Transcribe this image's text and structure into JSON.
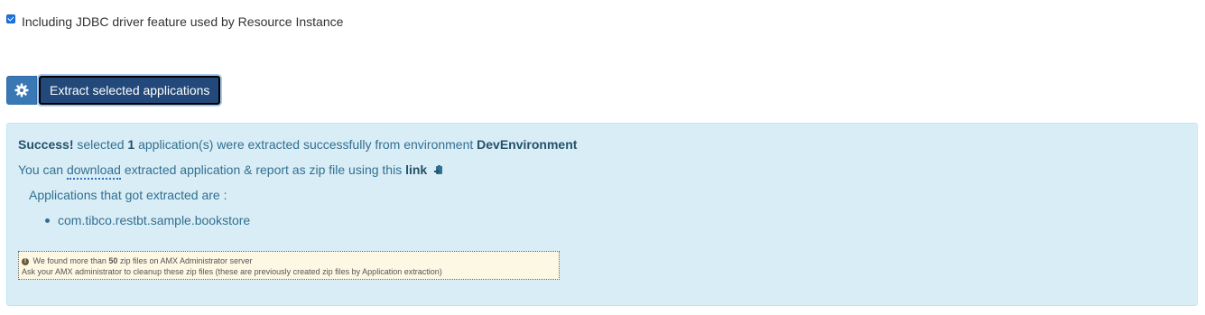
{
  "checkbox": {
    "label": "Including JDBC driver feature used by Resource Instance",
    "checked": true
  },
  "actions": {
    "gear_icon": "gear-icon",
    "extract_label": "Extract selected applications"
  },
  "alert": {
    "success_word": "Success!",
    "text_selected": "selected",
    "count": "1",
    "text_extracted": "application(s) were extracted successfully from environment",
    "environment": "DevEnvironment",
    "you_can": "You can",
    "download": "download",
    "text_report": "extracted application & report as zip file using this",
    "link": "link",
    "link_icon": "clipboard-download-icon",
    "apps_heading": "Applications that got extracted are :",
    "apps": [
      "com.tibco.restbt.sample.bookstore"
    ],
    "warning": {
      "icon": "exclamation-circle-icon",
      "pre": "We found more than",
      "count": "50",
      "post": "zip files on AMX Administrator server",
      "line2": "Ask your AMX administrator to cleanup these zip files (these are previously created zip files by Application extraction)"
    }
  },
  "colors": {
    "alert_bg": "#d9edf7",
    "alert_text": "#31708f",
    "button_primary": "#23497a",
    "warning_bg": "#fcf8e3"
  }
}
